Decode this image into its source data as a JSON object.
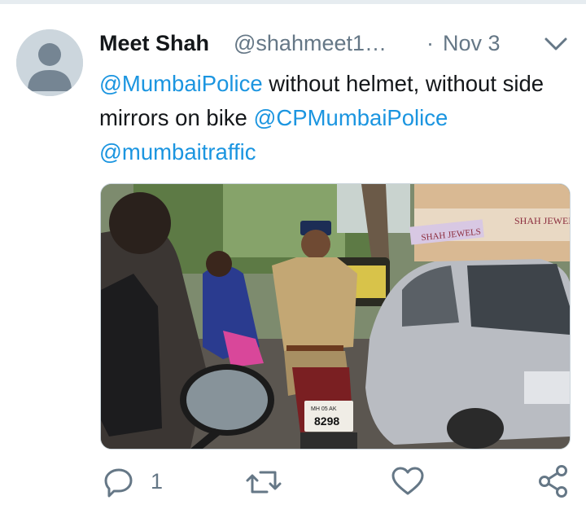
{
  "tweet": {
    "author_name": "Meet Shah",
    "author_handle": "@shahmeet1…",
    "separator": "·",
    "date": "Nov 3",
    "text": {
      "mention1": "@MumbaiPolice",
      "part1": " without helmet, without side mirrors on bike ",
      "mention2": "@CPMumbaiPolice",
      "space": " ",
      "mention3": "@mumbaitraffic"
    },
    "media": {
      "description": "Street photo of a policeman riding a motorbike without helmet in traffic",
      "shop_sign_1": "SHAH JEWELS",
      "shop_sign_2": "SHAH JEWEL",
      "plate_top": "MH 05 AK",
      "plate_number": "8298"
    }
  },
  "actions": {
    "reply_count": "1",
    "icons": [
      "reply-icon",
      "retweet-icon",
      "like-icon",
      "share-icon"
    ]
  },
  "colors": {
    "link": "#1b95e0",
    "text": "#14171a",
    "muted": "#657786",
    "avatar_bg": "#ccd6dd"
  }
}
